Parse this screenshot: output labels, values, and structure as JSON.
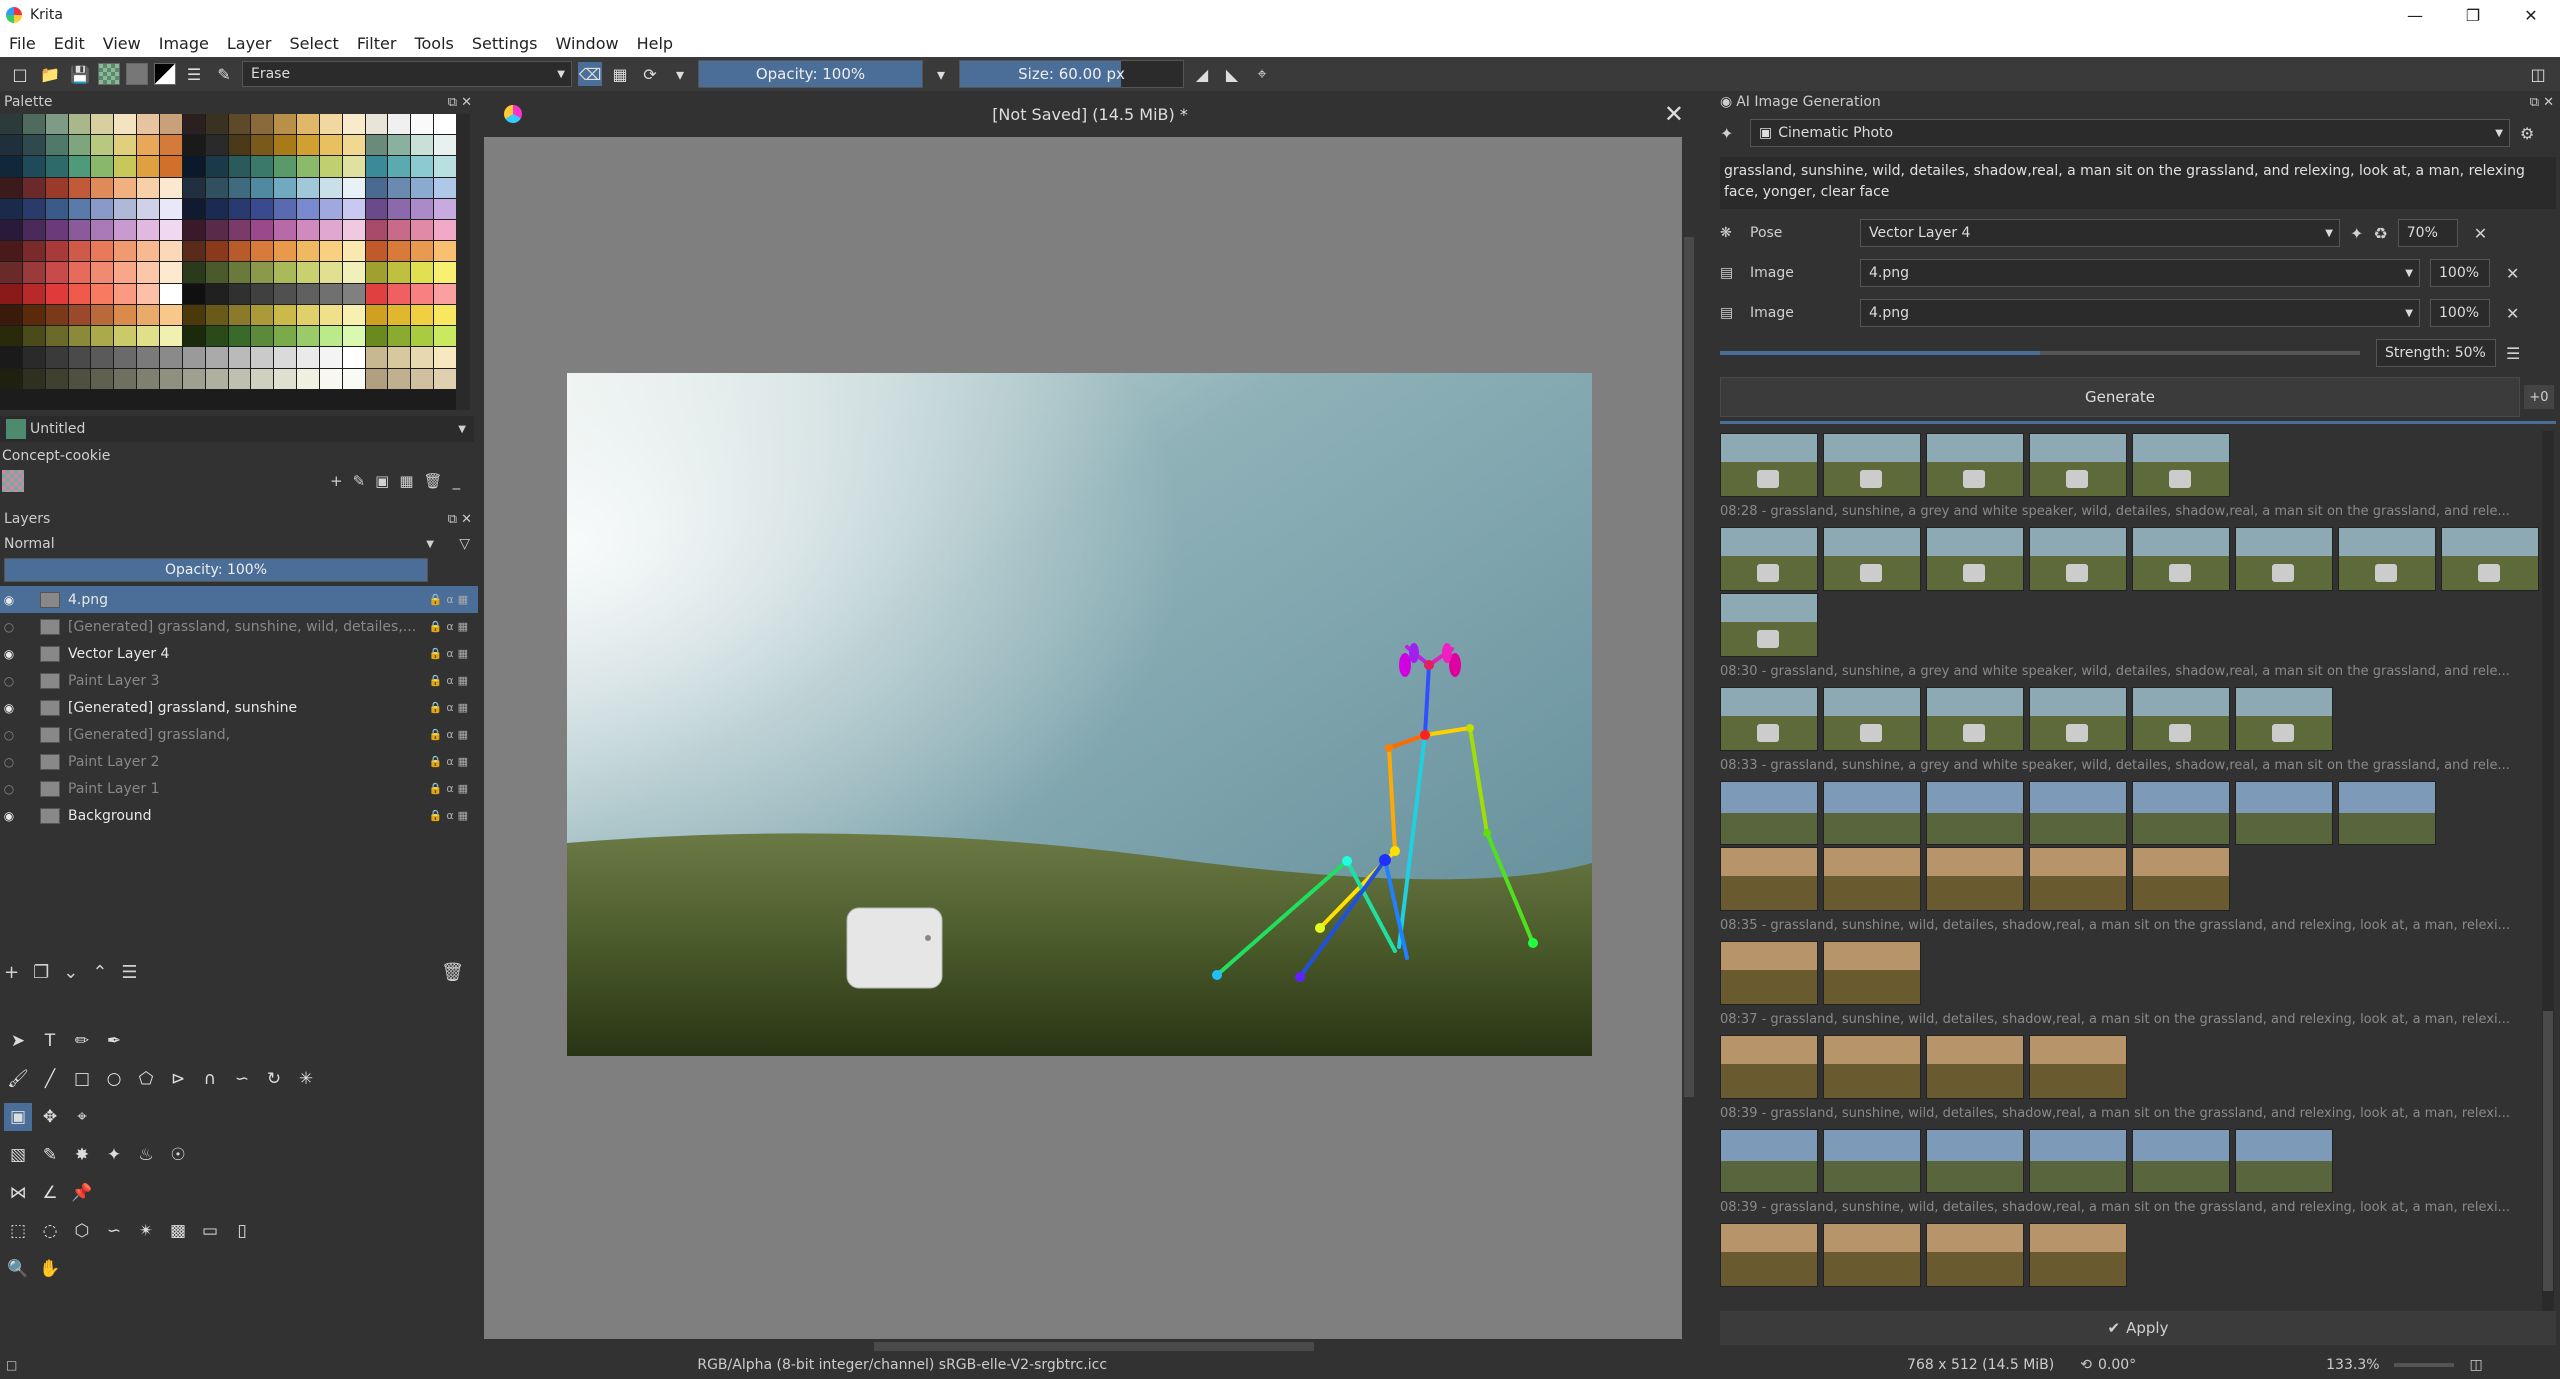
{
  "window": {
    "title": "Krita"
  },
  "menu": [
    "File",
    "Edit",
    "View",
    "Image",
    "Layer",
    "Select",
    "Filter",
    "Tools",
    "Settings",
    "Window",
    "Help"
  ],
  "toolbar": {
    "blend_mode": "Erase",
    "opacity": "Opacity: 100%",
    "opacity_fraction": 1.0,
    "size": "Size: 60.00 px",
    "size_fraction": 0.72
  },
  "palette": {
    "title": "Palette",
    "name": "Untitled",
    "set": "Concept-cookie",
    "colors": [
      "#2b3a3a",
      "#4e6b5e",
      "#7e9b86",
      "#a9b78a",
      "#d7cf9f",
      "#f3e3c1",
      "#e7c4a0",
      "#c8a07a",
      "#2b2020",
      "#3a3220",
      "#5c4a2a",
      "#8a6a3a",
      "#b8904a",
      "#e1b86a",
      "#f0d8a0",
      "#f8ebcc",
      "#e8e4d8",
      "#f0f0f0",
      "#fafafa",
      "#ffffff",
      "#1f2f3b",
      "#2f4a4f",
      "#4f7a6a",
      "#7ea57e",
      "#b8c87e",
      "#e0d07e",
      "#e8a858",
      "#d47a3a",
      "#1a1a1a",
      "#2a2a2a",
      "#4a3a1a",
      "#7a5a1a",
      "#a87a1a",
      "#d0a030",
      "#e8c060",
      "#f0d890",
      "#6a8a7a",
      "#8ab0a0",
      "#c8e0d8",
      "#e8f0f0",
      "#10283a",
      "#1f4a5a",
      "#2f6a6a",
      "#4f9a7a",
      "#8ab86a",
      "#c8c85a",
      "#e0a040",
      "#d0702a",
      "#0a1a2a",
      "#1a3a4a",
      "#2a5a5a",
      "#3a7a6a",
      "#5a9a6a",
      "#8aba6a",
      "#c0d070",
      "#e0e0a0",
      "#3a8a9a",
      "#5aaab0",
      "#8acad0",
      "#b8e0e0",
      "#3a1a1a",
      "#6a2a2a",
      "#9a3a2a",
      "#c05a3a",
      "#e08a5a",
      "#f0b080",
      "#f8d0a8",
      "#fae8d0",
      "#203040",
      "#305060",
      "#406a80",
      "#508aa0",
      "#70aac0",
      "#a0c8d8",
      "#c8e0e8",
      "#e8f0f8",
      "#4a6a90",
      "#6a8ab0",
      "#8aaad0",
      "#b0c8e8",
      "#1a2a4a",
      "#2a3a6a",
      "#3a5a8a",
      "#5a7aaa",
      "#8a9ac8",
      "#b0b8d8",
      "#d0d0e8",
      "#e8e8f8",
      "#101a30",
      "#1a2a50",
      "#2a3a70",
      "#3a4a90",
      "#5a6ab0",
      "#7a8ad0",
      "#a0a8e0",
      "#c8c8f0",
      "#6a4a8a",
      "#8a6aaa",
      "#aa8ac8",
      "#c8aae0",
      "#2a1a3a",
      "#4a2a5a",
      "#6a3a7a",
      "#8a5a9a",
      "#aa7ab8",
      "#c89ad0",
      "#e0b8e0",
      "#f0d8f0",
      "#3a1a2a",
      "#5a2a4a",
      "#7a3a6a",
      "#9a4a8a",
      "#b86aa8",
      "#d08ac0",
      "#e0a8d0",
      "#f0c8e0",
      "#a84a6a",
      "#c86a8a",
      "#e08aa8",
      "#f0aac8",
      "#4a1a1a",
      "#7a2a2a",
      "#a83a3a",
      "#d05a4a",
      "#e87a5a",
      "#f09a70",
      "#f8b890",
      "#fad8b8",
      "#5a2a1a",
      "#8a3a1a",
      "#b85a2a",
      "#d87a3a",
      "#e89a4a",
      "#f0b860",
      "#f8d080",
      "#fae8b0",
      "#c05a2a",
      "#d87a3a",
      "#e89a50",
      "#f8c070",
      "#6a2a2a",
      "#9a3a3a",
      "#c84a4a",
      "#e86a5a",
      "#f08a70",
      "#f8a888",
      "#fac8a8",
      "#fde8d0",
      "#2a3a1a",
      "#4a5a2a",
      "#6a7a3a",
      "#8a9a4a",
      "#aaba5a",
      "#c8d070",
      "#e0e090",
      "#f0f0b8",
      "#a0a030",
      "#c0c040",
      "#e0e050",
      "#f8f070",
      "#8a1a1a",
      "#b82a2a",
      "#e03a3a",
      "#f05a4a",
      "#f87a60",
      "#fa9a80",
      "#fcc0a8",
      "#ffffff",
      "#101010",
      "#202020",
      "#303030",
      "#404040",
      "#505050",
      "#606060",
      "#707070",
      "#808080",
      "#e04040",
      "#f06060",
      "#f88080",
      "#faa0a0",
      "#3a1a0a",
      "#5a2a0a",
      "#7a3a1a",
      "#9a4a2a",
      "#ba6a3a",
      "#da8a4a",
      "#eaaa6a",
      "#f8c88a",
      "#4a3a0a",
      "#6a5a1a",
      "#8a7a2a",
      "#aa9a3a",
      "#caba4a",
      "#e0d06a",
      "#f0e08a",
      "#f8f0b0",
      "#d0a020",
      "#e0b830",
      "#f0d040",
      "#f8e860",
      "#2a2a0a",
      "#4a4a1a",
      "#6a6a2a",
      "#8a8a3a",
      "#aaaa4a",
      "#caca6a",
      "#e0e08a",
      "#f0f0b0",
      "#1a2a0a",
      "#2a4a1a",
      "#3a6a2a",
      "#5a8a3a",
      "#7aaa4a",
      "#9aca6a",
      "#baea8a",
      "#daf8b0",
      "#6a8a20",
      "#8aaa30",
      "#aaca40",
      "#cae860",
      "#1a1a1a",
      "#2a2a2a",
      "#3a3a3a",
      "#4a4a4a",
      "#5a5a5a",
      "#6a6a6a",
      "#7a7a7a",
      "#8a8a8a",
      "#9a9a9a",
      "#aaaaaa",
      "#bababa",
      "#cacaca",
      "#dadada",
      "#eaeaea",
      "#f4f4f4",
      "#ffffff",
      "#c8b890",
      "#d8c8a0",
      "#e8d8b0",
      "#f8e8c0",
      "#202010",
      "#303020",
      "#404030",
      "#505040",
      "#606050",
      "#707060",
      "#808070",
      "#909080",
      "#a0a090",
      "#b0b0a0",
      "#c0c0b0",
      "#d0d0c0",
      "#e0e0d0",
      "#f0f0e0",
      "#f8f8f0",
      "#fafaf5",
      "#b0a080",
      "#c0b090",
      "#d0c0a0",
      "#e0d0b0"
    ]
  },
  "layers": {
    "title": "Layers",
    "blend": "Normal",
    "opacity": "Opacity: 100%",
    "opacity_fraction": 1.0,
    "items": [
      {
        "name": "4.png",
        "visible": true,
        "selected": true
      },
      {
        "name": "[Generated] grassland, sunshine, wild, detailes,...",
        "visible": false,
        "selected": false
      },
      {
        "name": "Vector Layer 4",
        "visible": true,
        "selected": false
      },
      {
        "name": "Paint Layer 3",
        "visible": false,
        "selected": false
      },
      {
        "name": "[Generated] grassland, sunshine",
        "visible": true,
        "selected": false
      },
      {
        "name": "[Generated] grassland,",
        "visible": false,
        "selected": false
      },
      {
        "name": "Paint Layer 2",
        "visible": false,
        "selected": false
      },
      {
        "name": "Paint Layer 1",
        "visible": false,
        "selected": false
      },
      {
        "name": "Background",
        "visible": true,
        "selected": false
      }
    ]
  },
  "canvas": {
    "title": "[Not Saved]  (14.5 MiB) *"
  },
  "ai": {
    "title": "AI Image Generation",
    "style": "Cinematic Photo",
    "prompt": "grassland, sunshine, wild, detailes, shadow,real, a man sit on the grassland, and relexing, look at, a man, relexing face, yonger, clear face",
    "controls": [
      {
        "kind": "Pose",
        "source": "Vector Layer 4",
        "strength": "70%"
      },
      {
        "kind": "Image",
        "source": "4.png",
        "strength": "100%"
      },
      {
        "kind": "Image",
        "source": "4.png",
        "strength": "100%"
      }
    ],
    "strength": "Strength: 50%",
    "strength_fraction": 0.5,
    "generate": "Generate",
    "seed_badge": "+0",
    "apply": "Apply",
    "history": [
      {
        "caption": "",
        "tiles": 5,
        "tone": "green"
      },
      {
        "caption": "08:28 - grassland, sunshine, a grey and white speaker, wild, detailes, shadow,real, a man sit on the grassland, and rele...",
        "tiles": 8,
        "tone": "green"
      },
      {
        "caption": "",
        "tiles": 1,
        "tone": "green"
      },
      {
        "caption": "08:30 - grassland, sunshine, a grey and white speaker, wild, detailes, shadow,real, a man sit on the grassland, and rele...",
        "tiles": 6,
        "tone": "green"
      },
      {
        "caption": "08:33 - grassland, sunshine, a grey and white speaker, wild, detailes, shadow,real, a man sit on the grassland, and rele...",
        "tiles": 7,
        "tone": "blue"
      },
      {
        "caption": "",
        "tiles": 5,
        "tone": "warm"
      },
      {
        "caption": "08:35 - grassland, sunshine, wild, detailes, shadow,real, a man sit on the grassland, and relexing, look at, a man, relexi...",
        "tiles": 2,
        "tone": "warm"
      },
      {
        "caption": "08:37 - grassland, sunshine, wild, detailes, shadow,real, a man sit on the grassland, and relexing, look at, a man, relexi...",
        "tiles": 4,
        "tone": "warm"
      },
      {
        "caption": "08:39 - grassland, sunshine, wild, detailes, shadow,real, a man sit on the grassland, and relexing, look at, a man, relexi...",
        "tiles": 6,
        "tone": "blue"
      },
      {
        "caption": "08:39 - grassland, sunshine, wild, detailes, shadow,real, a man sit on the grassland, and relexing, look at, a man, relexi...",
        "tiles": 4,
        "tone": "warm"
      }
    ]
  },
  "status": {
    "colorspace": "RGB/Alpha (8-bit integer/channel)  sRGB-elle-V2-srgbtrc.icc",
    "dimensions": "768 x 512 (14.5 MiB)",
    "rotation": "0.00°",
    "zoom": "133.3%"
  }
}
